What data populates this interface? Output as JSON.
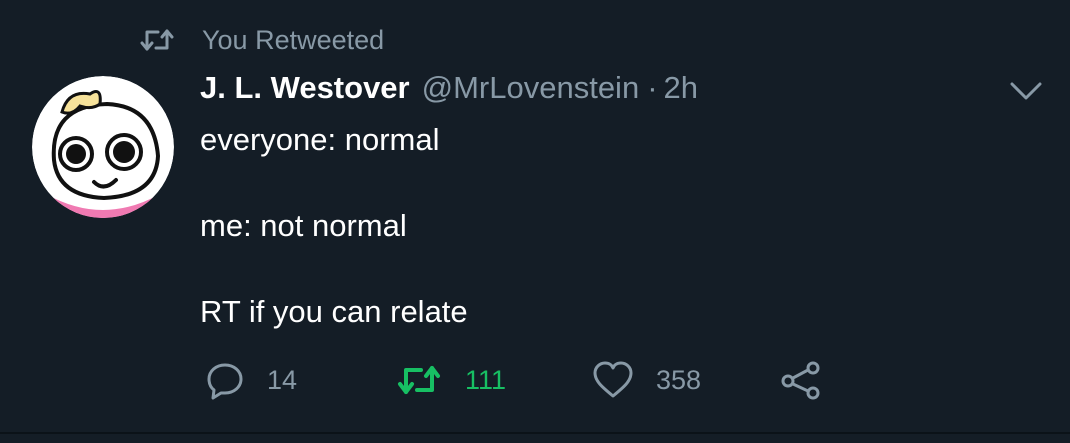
{
  "retweet_header": {
    "icon": "retweet-icon",
    "text": "You Retweeted"
  },
  "tweet": {
    "avatar": "avatar",
    "display_name": "J. L. Westover",
    "handle": "@MrLovenstein",
    "separator": "·",
    "time": "2h",
    "menu_icon": "chevron-down-icon",
    "body": {
      "line1": "everyone: normal",
      "line2": "me: not normal",
      "line3": "RT if you can relate"
    }
  },
  "actions": {
    "reply": {
      "icon": "reply-icon",
      "count": "14"
    },
    "retweet": {
      "icon": "retweet-icon",
      "count": "111",
      "active_color": "#17bf63"
    },
    "like": {
      "icon": "heart-icon",
      "count": "358"
    },
    "share": {
      "icon": "share-icon"
    }
  },
  "colors": {
    "background": "#141d26",
    "text_primary": "#ffffff",
    "text_secondary": "#8899a6",
    "retweet_green": "#17bf63"
  }
}
